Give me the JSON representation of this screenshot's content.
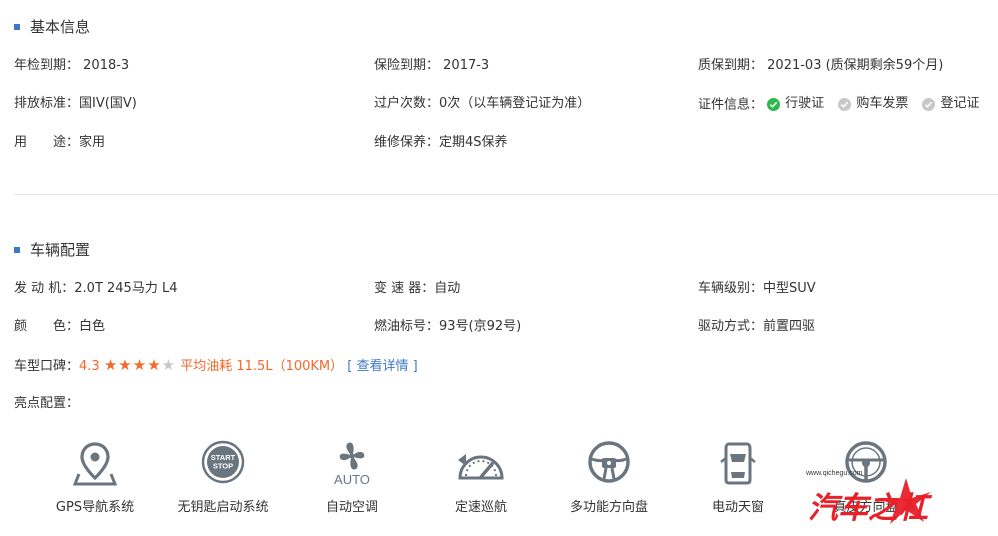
{
  "basic": {
    "title": "基本信息",
    "rows": [
      [
        {
          "label": "年检到期：",
          "value": "2018-3"
        },
        {
          "label": "保险到期：",
          "value": "2017-3"
        },
        {
          "label": "质保到期：",
          "value": "2021-03 (质保期剩余59个月)"
        }
      ],
      [
        {
          "label": "排放标准：",
          "value": "国IV(国V)"
        },
        {
          "label": "过户次数：",
          "value": "0次（以车辆登记证为准）"
        },
        {
          "label": "证件信息：",
          "value": ""
        }
      ],
      [
        {
          "label": "用　　途：",
          "value": "家用"
        },
        {
          "label": "维修保养：",
          "value": "定期4S保养"
        },
        {
          "label": "",
          "value": ""
        }
      ]
    ],
    "certs": [
      {
        "label": "行驶证",
        "status": "verified",
        "color": "#2db84d"
      },
      {
        "label": "购车发票",
        "status": "unverified",
        "color": "#c8c8c8"
      },
      {
        "label": "登记证",
        "status": "unverified",
        "color": "#c8c8c8"
      }
    ]
  },
  "config": {
    "title": "车辆配置",
    "rows": [
      [
        {
          "label": "发 动 机：",
          "value": "2.0T 245马力 L4"
        },
        {
          "label": "变 速 器：",
          "value": "自动"
        },
        {
          "label": "车辆级别：",
          "value": "中型SUV"
        }
      ],
      [
        {
          "label": "颜　　色：",
          "value": "白色"
        },
        {
          "label": "燃油标号：",
          "value": "93号(京92号)"
        },
        {
          "label": "驱动方式：",
          "value": "前置四驱"
        }
      ]
    ],
    "rating": {
      "label": "车型口碑：",
      "score": "4.3",
      "stars": 4.3,
      "fuel": "平均油耗 11.5L（100KM）",
      "details_link": "[ 查看详情 ]"
    },
    "highlights_label": "亮点配置：",
    "features": [
      {
        "icon": "gps-icon",
        "label": "GPS导航系统"
      },
      {
        "icon": "start-stop-icon",
        "label": "无钥匙启动系统",
        "icon_text": "START STOP"
      },
      {
        "icon": "auto-ac-icon",
        "label": "自动空调",
        "icon_text": "AUTO"
      },
      {
        "icon": "cruise-control-icon",
        "label": "定速巡航"
      },
      {
        "icon": "multifunction-steering-icon",
        "label": "多功能方向盘"
      },
      {
        "icon": "sunroof-icon",
        "label": "电动天窗"
      },
      {
        "icon": "leather-steering-icon",
        "label": "真皮方向盘"
      }
    ]
  },
  "watermark": {
    "text": "www.qichegu.com",
    "logo_text": "汽车之杠"
  },
  "colors": {
    "accent": "#3c78c8",
    "orange": "#f06a2b",
    "icon_gray": "#6b7580"
  }
}
